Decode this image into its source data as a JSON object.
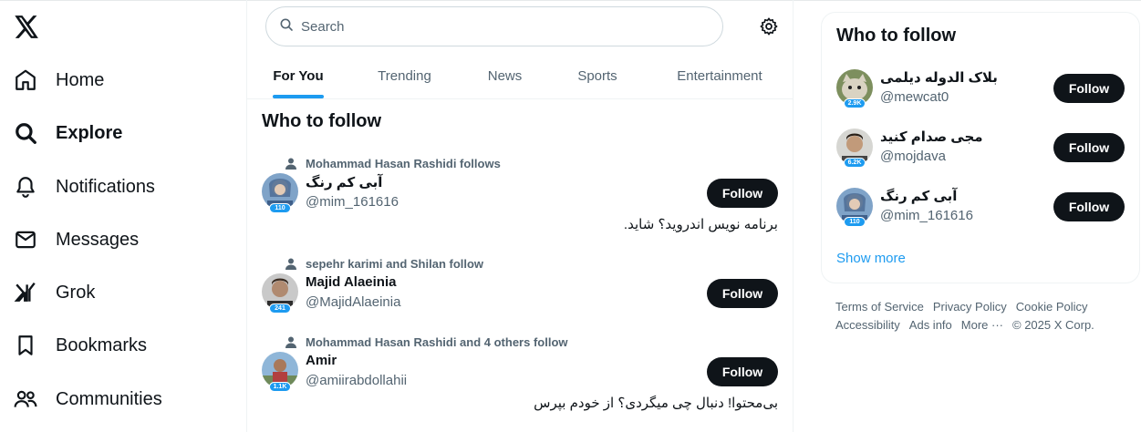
{
  "nav": {
    "items": [
      {
        "label": "Home",
        "icon": "home-icon"
      },
      {
        "label": "Explore",
        "icon": "search-icon"
      },
      {
        "label": "Notifications",
        "icon": "bell-icon"
      },
      {
        "label": "Messages",
        "icon": "envelope-icon"
      },
      {
        "label": "Grok",
        "icon": "grok-icon"
      },
      {
        "label": "Bookmarks",
        "icon": "bookmark-icon"
      },
      {
        "label": "Communities",
        "icon": "people-icon"
      }
    ]
  },
  "search": {
    "placeholder": "Search"
  },
  "tabs": [
    {
      "label": "For You"
    },
    {
      "label": "Trending"
    },
    {
      "label": "News"
    },
    {
      "label": "Sports"
    },
    {
      "label": "Entertainment"
    }
  ],
  "main": {
    "section_title": "Who to follow",
    "follow_label": "Follow",
    "cards": [
      {
        "context": "Mohammad Hasan Rashidi follows",
        "name": "آبی کم رنگ",
        "handle": "@mim_161616",
        "badge": "110",
        "bio": "برنامه نویس اندروید؟ شاید."
      },
      {
        "context": "sepehr karimi and Shilan follow",
        "name": "Majid Alaeinia",
        "handle": "@MajidAlaeinia",
        "badge": "241",
        "bio": ""
      },
      {
        "context": "Mohammad Hasan Rashidi and 4 others follow",
        "name": "Amir",
        "handle": "@amiirabdollahii",
        "badge": "1.1K",
        "bio": "بی‌محتوا! دنبال چی میگردی؟ از خودم بپرس"
      }
    ]
  },
  "sidebar": {
    "title": "Who to follow",
    "follow_label": "Follow",
    "show_more": "Show more",
    "users": [
      {
        "name": "بلاک الدوله دیلمی",
        "handle": "@mewcat0",
        "badge": "2.9K"
      },
      {
        "name": "مجی صدام کنید",
        "handle": "@mojdava",
        "badge": "6.2K"
      },
      {
        "name": "آبی کم رنگ",
        "handle": "@mim_161616",
        "badge": "110"
      }
    ]
  },
  "footer": {
    "terms": "Terms of Service",
    "privacy": "Privacy Policy",
    "cookie": "Cookie Policy",
    "accessibility": "Accessibility",
    "ads": "Ads info",
    "more": "More ···",
    "copyright": "© 2025 X Corp."
  },
  "colors": {
    "accent": "#1d9bf0",
    "text": "#0f1419",
    "muted": "#536471",
    "border": "#eff3f4"
  }
}
